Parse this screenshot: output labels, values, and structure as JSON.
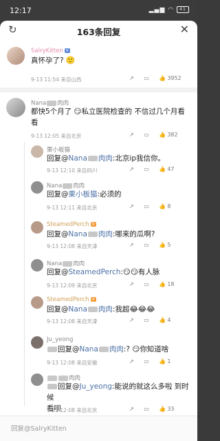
{
  "status": {
    "time": "12:17",
    "icons": "▪ ▪ ▪ ▮",
    "battery": "41"
  },
  "header": {
    "title": "163条回复"
  },
  "comments": [
    {
      "name": "SalryKitten",
      "badge": "",
      "text": "真怀孕了?",
      "date": "9-13 11:54",
      "loc": "来自山西",
      "likes": "3952"
    },
    {
      "name": "Nana",
      "name_suffix": "肉肉",
      "text_line1": "都快5个月了",
      "text_line1b": "私立医院检查的 不信过几个月看",
      "text_line2": "看",
      "date": "9-13 12:05",
      "loc": "来自北京",
      "likes": "382"
    },
    {
      "name": "栗小板猫",
      "text_prefix": "回复@",
      "mention": "Nana",
      "mention_suffix": "肉肉",
      "text": ":北京ip我信你。",
      "date": "9-13 12:10",
      "loc": "来自四川",
      "likes": "47"
    },
    {
      "name": "Nana",
      "name_suffix": "肉肉",
      "text_prefix": "回复@",
      "mention": "栗小板猫",
      "text": ":必须的",
      "date": "9-13 12:11",
      "loc": "来自北京",
      "likes": "8"
    },
    {
      "name": "SteamedPerch",
      "text_prefix": "回复@",
      "mention": "Nana",
      "mention_suffix": "肉肉",
      "text": ":哪来的瓜啊?",
      "date": "9-13 12:08",
      "loc": "来自天津",
      "likes": "5"
    },
    {
      "name": "Nana",
      "name_suffix": "肉肉",
      "text_prefix": "回复@",
      "mention": "SteamedPerch",
      "text": ":",
      "text_after": "有人脉",
      "date": "9-13 12:09",
      "loc": "来自北京",
      "likes": "18"
    },
    {
      "name": "SteamedPerch",
      "text_prefix": "回复@",
      "mention": "Nana",
      "mention_suffix": "肉肉",
      "text": ":我超",
      "date": "9-13 12:08",
      "loc": "来自天津",
      "likes": "4"
    },
    {
      "name": "Ju_yeong",
      "text_prefix": "回复@",
      "mention": "Nana",
      "mention_suffix": "肉肉",
      "text": ":?",
      "text_after": "你知道啥",
      "date": "9-13 12:08",
      "loc": "来自安徽",
      "likes": "1"
    },
    {
      "name": "",
      "name_suffix": "肉肉",
      "text_prefix": "回复@",
      "mention": "Ju_yeong",
      "text": ":能说的就这么多啦 到时候",
      "text_line2": "看呗",
      "date": "9-13 12:08",
      "loc": "来自北京",
      "likes": "33"
    }
  ],
  "bottom": {
    "placeholder": "回复@SalryKitten"
  }
}
